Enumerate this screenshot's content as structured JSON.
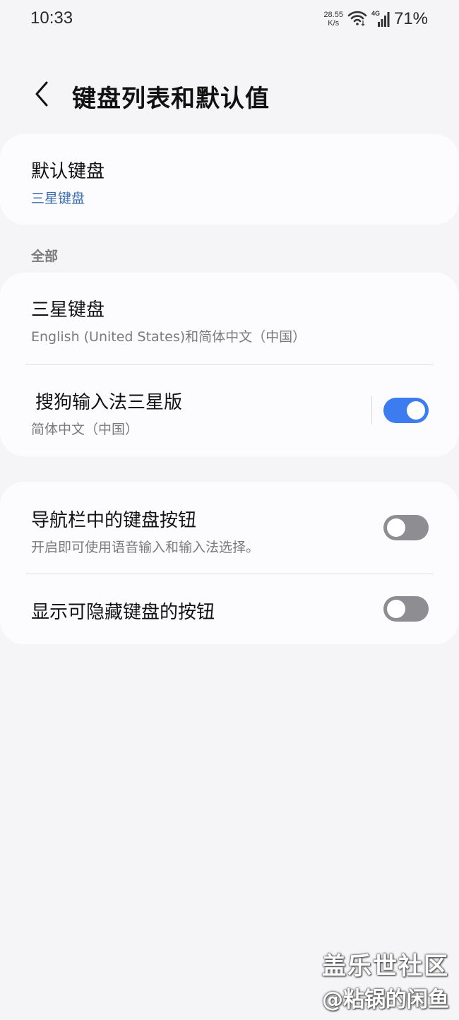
{
  "status_bar": {
    "time": "10:33",
    "net_speed_value": "28.55",
    "net_speed_unit": "K/s",
    "network_type": "4G",
    "battery": "71%"
  },
  "header": {
    "title": "键盘列表和默认值"
  },
  "default_keyboard": {
    "title": "默认键盘",
    "value": "三星键盘"
  },
  "section_all": {
    "label": "全部"
  },
  "keyboards": [
    {
      "title": "三星键盘",
      "subtitle": "English (United States)和简体中文（中国）"
    },
    {
      "title": "搜狗输入法三星版",
      "subtitle": "简体中文（中国）",
      "enabled": true
    }
  ],
  "settings": [
    {
      "title": "导航栏中的键盘按钮",
      "subtitle": "开启即可使用语音输入和输入法选择。",
      "enabled": false
    },
    {
      "title": "显示可隐藏键盘的按钮",
      "enabled": false
    }
  ],
  "colors": {
    "accent": "#3c7bf0",
    "toggle_off": "#8e8e92",
    "link": "#3a6cb4",
    "background": "#f5f5f8",
    "card": "#fcfcfe"
  },
  "watermark": {
    "line1": "盖乐世社区",
    "line2": "@粘锅的闲鱼"
  }
}
